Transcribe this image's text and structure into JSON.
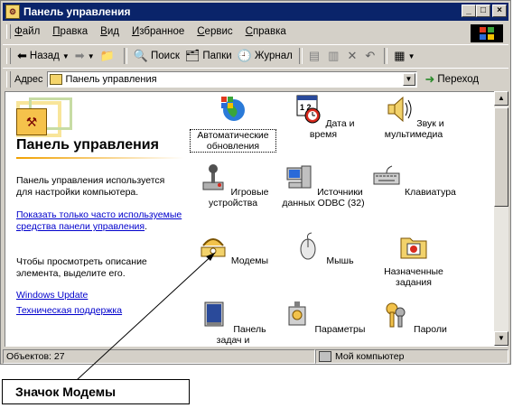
{
  "window": {
    "title": "Панель управления"
  },
  "menu": [
    {
      "ul": "Ф",
      "rest": "айл"
    },
    {
      "ul": "П",
      "rest": "равка"
    },
    {
      "ul": "В",
      "rest": "ид"
    },
    {
      "ul": "И",
      "rest": "збранное"
    },
    {
      "ul": "С",
      "rest": "ервис"
    },
    {
      "ul": "С",
      "rest": "правка"
    }
  ],
  "toolbar": {
    "back": "Назад",
    "search": "Поиск",
    "folders": "Папки",
    "journal": "Журнал"
  },
  "address": {
    "label": "Адрес",
    "value": "Панель управления",
    "go": "Переход"
  },
  "left_pane": {
    "title": "Панель управления",
    "description": "Панель управления используется для настройки компьютера.",
    "link_show_common": "Показать только часто используемые средства панели управления",
    "select_hint": "Чтобы просмотреть описание элемента, выделите его.",
    "link_windows_update": "Windows Update",
    "link_support": "Техническая поддержка"
  },
  "items": [
    {
      "label": "Автоматические обновления",
      "icon": "globe-update-icon"
    },
    {
      "label": "Дата и время",
      "icon": "calendar-clock-icon"
    },
    {
      "label": "Звук и мультимедиа",
      "icon": "speaker-icon"
    },
    {
      "label": "Игровые устройства",
      "icon": "joystick-icon"
    },
    {
      "label": "Источники данных ODBC (32)",
      "icon": "odbc-icon"
    },
    {
      "label": "Клавиатура",
      "icon": "keyboard-icon"
    },
    {
      "label": "Модемы",
      "icon": "modem-phone-icon"
    },
    {
      "label": "Мышь",
      "icon": "mouse-icon"
    },
    {
      "label": "Назначенные задания",
      "icon": "scheduled-tasks-icon"
    },
    {
      "label": "Панель задач и",
      "icon": "taskbar-icon"
    },
    {
      "label": "Параметры",
      "icon": "settings-icon"
    },
    {
      "label": "Пароли",
      "icon": "keys-icon"
    }
  ],
  "status": {
    "objects": "Объектов: 27",
    "location": "Мой компьютер"
  },
  "callout": {
    "text": "Значок Модемы"
  }
}
